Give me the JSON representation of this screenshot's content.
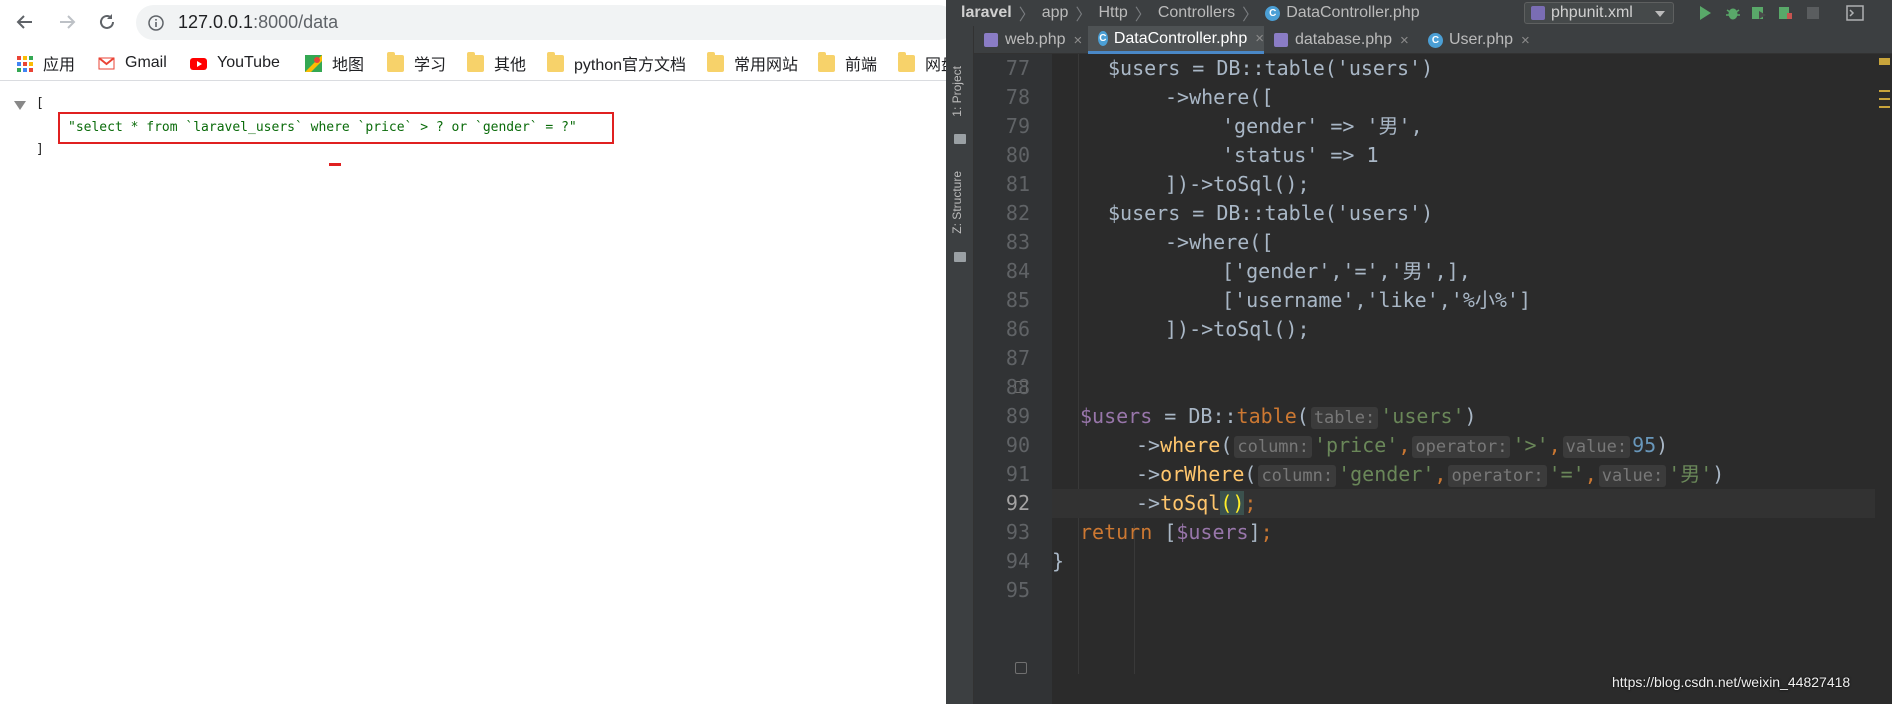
{
  "browser": {
    "url_host": "127.0.0.1",
    "url_path": ":8000/data",
    "bookmarks": [
      "应用",
      "Gmail",
      "YouTube",
      "地图",
      "学习",
      "其他",
      "python官方文档",
      "常用网站",
      "前端",
      "网盘"
    ],
    "json": {
      "open_bracket": "[",
      "close_bracket": "]",
      "value": "\"select * from `laravel_users` where `price` > ? or `gender` = ?\""
    }
  },
  "ide": {
    "breadcrumbs": [
      "laravel",
      "app",
      "Http",
      "Controllers",
      "DataController.php"
    ],
    "run_config": "phpunit.xml",
    "tool_windows": [
      "1: Project",
      "Z: Structure"
    ],
    "tabs": [
      {
        "label": "web.php",
        "active": false
      },
      {
        "label": "DataController.php",
        "active": true
      },
      {
        "label": "database.php",
        "active": false
      },
      {
        "label": "User.php",
        "active": false
      }
    ],
    "current_line": "92",
    "line_numbers": [
      "77",
      "78",
      "79",
      "80",
      "81",
      "82",
      "83",
      "84",
      "85",
      "86",
      "87",
      "88",
      "89",
      "90",
      "91",
      "92",
      "93",
      "94",
      "95"
    ],
    "code": {
      "l77": "$users = DB::table('users')",
      "l78": "->where([",
      "l79": "'gender' => '男',",
      "l80": "'status' => 1",
      "l81": "])->toSql();",
      "l82": "$users = DB::table('users')",
      "l83": "->where([",
      "l84": "['gender','=','男',],",
      "l85": "['username','like','%小%']",
      "l86": "])->toSql();",
      "l89_var": "$users",
      "l89_eq": " = DB::",
      "l89_fn": "table",
      "l89_hint": "table:",
      "l89_str": "'users'",
      "l90_arrow": "->",
      "l90_fn": "where",
      "l90_hint1": "column:",
      "l90_str1": "'price'",
      "l90_hint2": "operator:",
      "l90_str2": "'>'",
      "l90_hint3": "value:",
      "l90_num": "95",
      "l91_arrow": "->",
      "l91_fn": "orWhere",
      "l91_hint1": "column:",
      "l91_str1": "'gender'",
      "l91_hint2": "operator:",
      "l91_str2": "'='",
      "l91_hint3": "value:",
      "l91_str3": "'男'",
      "l92_arrow": "->",
      "l92_fn": "toSql",
      "l93_kw": "return",
      "l93_var": "$users",
      "l94": "}"
    }
  },
  "watermark": "https://blog.csdn.net/weixin_44827418",
  "colors": {
    "ide_bg": "#2b2b2b",
    "string": "#6a8759",
    "variable": "#9876aa",
    "keyword": "#cc7832",
    "function": "#ffc66d",
    "number": "#6897bb",
    "highlight_border": "#e02020"
  }
}
